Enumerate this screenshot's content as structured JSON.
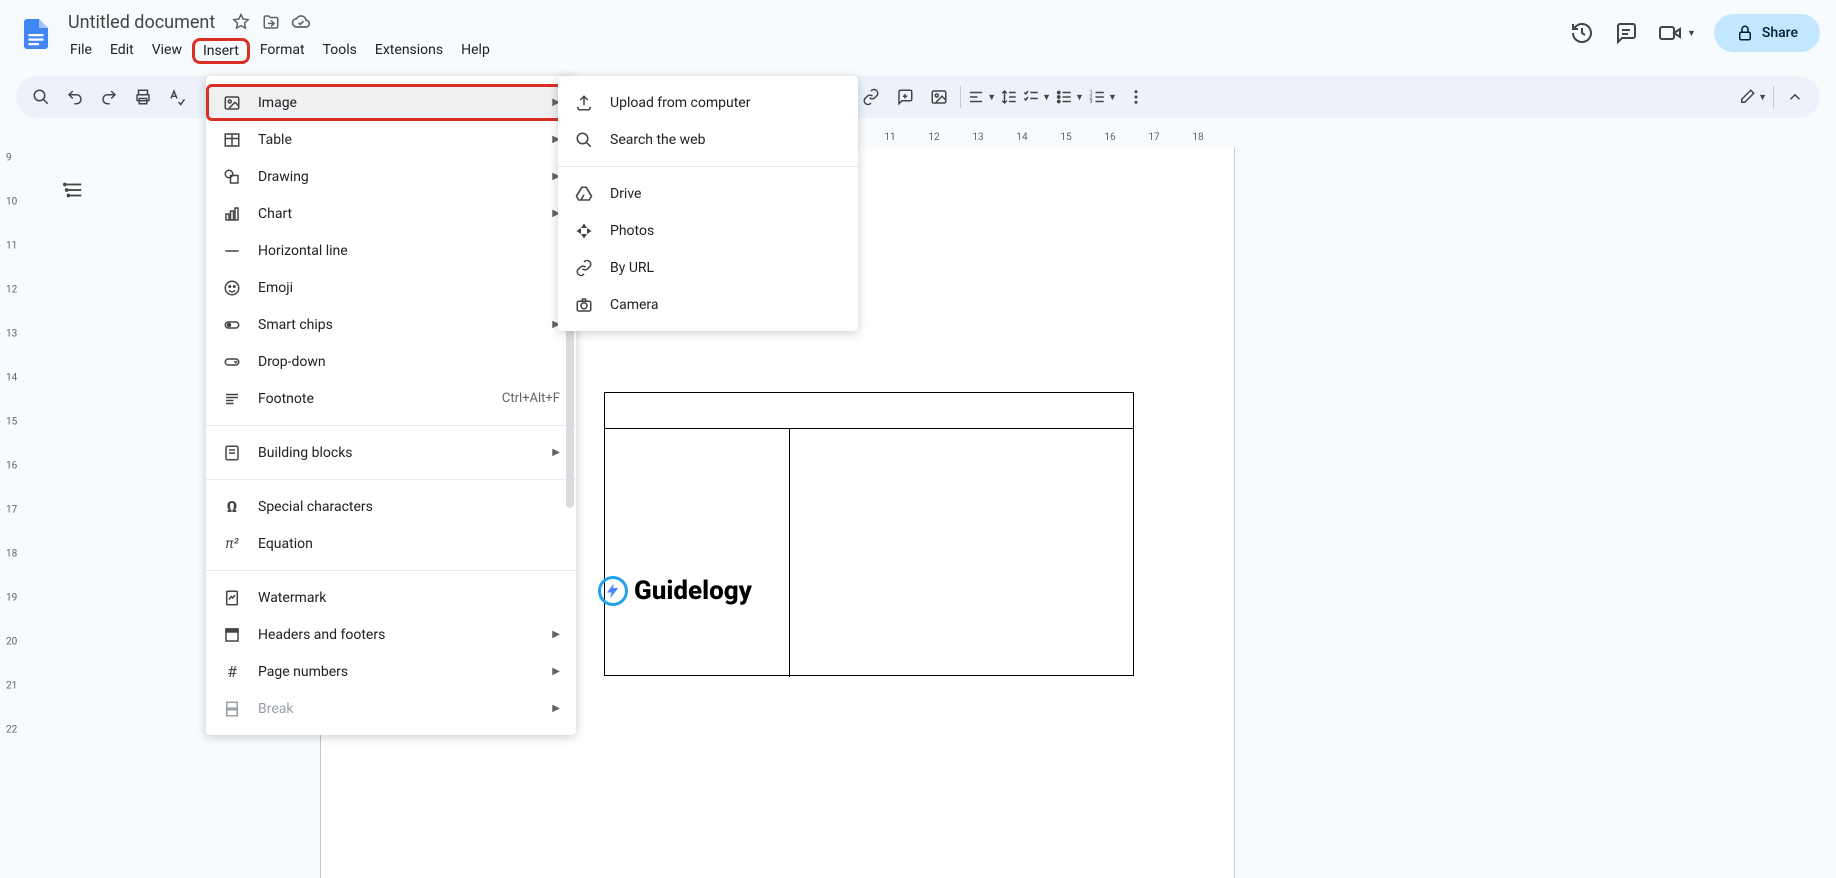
{
  "header": {
    "title": "Untitled document",
    "menus": {
      "file": "File",
      "edit": "Edit",
      "view": "View",
      "insert": "Insert",
      "format": "Format",
      "tools": "Tools",
      "extensions": "Extensions",
      "help": "Help"
    },
    "share": "Share"
  },
  "ruler_h": [
    "11",
    "12",
    "13",
    "14",
    "15",
    "16",
    "17",
    "18"
  ],
  "ruler_v": [
    "9",
    "10",
    "11",
    "12",
    "13",
    "14",
    "15",
    "16",
    "17",
    "18",
    "19",
    "20",
    "21",
    "22"
  ],
  "insert_menu": {
    "image": "Image",
    "table": "Table",
    "drawing": "Drawing",
    "chart": "Chart",
    "hline": "Horizontal line",
    "emoji": "Emoji",
    "smartchips": "Smart chips",
    "dropdown": "Drop-down",
    "footnote": "Footnote",
    "footnote_sc": "Ctrl+Alt+F",
    "buildingblocks": "Building blocks",
    "specialchars": "Special characters",
    "equation": "Equation",
    "watermark": "Watermark",
    "headersfooters": "Headers and footers",
    "pagenumbers": "Page numbers",
    "break": "Break"
  },
  "image_submenu": {
    "upload": "Upload from computer",
    "search": "Search the web",
    "drive": "Drive",
    "photos": "Photos",
    "byurl": "By URL",
    "camera": "Camera"
  },
  "watermark_text": "Guidelogy"
}
